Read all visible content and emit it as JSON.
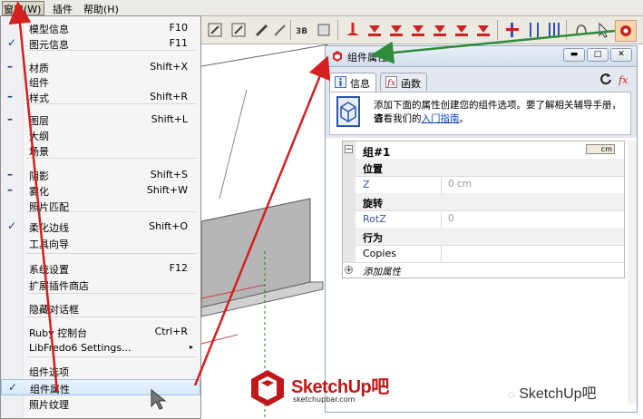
{
  "menubar": {
    "window": "窗口(W)",
    "plugins": "插件",
    "help": "帮助(H)"
  },
  "menu": {
    "items": [
      {
        "label": "模型信息",
        "shortcut": "F10",
        "mark": ""
      },
      {
        "label": "图元信息",
        "shortcut": "F11",
        "mark": "✓"
      },
      {
        "label": "材质",
        "shortcut": "Shift+X",
        "mark": "–"
      },
      {
        "label": "组件",
        "shortcut": "",
        "mark": ""
      },
      {
        "label": "样式",
        "shortcut": "Shift+R",
        "mark": "–"
      },
      {
        "label": "图层",
        "shortcut": "Shift+L",
        "mark": "–"
      },
      {
        "label": "大纲",
        "shortcut": "",
        "mark": ""
      },
      {
        "label": "场景",
        "shortcut": "",
        "mark": ""
      },
      {
        "label": "阴影",
        "shortcut": "Shift+S",
        "mark": "–"
      },
      {
        "label": "雾化",
        "shortcut": "Shift+W",
        "mark": "–"
      },
      {
        "label": "照片匹配",
        "shortcut": "",
        "mark": ""
      },
      {
        "label": "柔化边线",
        "shortcut": "Shift+O",
        "mark": "✓"
      },
      {
        "label": "工具向导",
        "shortcut": "",
        "mark": ""
      },
      {
        "label": "系统设置",
        "shortcut": "F12",
        "mark": ""
      },
      {
        "label": "扩展插件商店",
        "shortcut": "",
        "mark": ""
      },
      {
        "label": "隐藏对话框",
        "shortcut": "",
        "mark": ""
      },
      {
        "label": "Ruby 控制台",
        "shortcut": "Ctrl+R",
        "mark": ""
      },
      {
        "label": "LibFredo6 Settings...",
        "shortcut": "",
        "mark": "",
        "submenu": "▸"
      },
      {
        "label": "组件选项",
        "shortcut": "",
        "mark": ""
      },
      {
        "label": "组件属性",
        "shortcut": "",
        "mark": "✓"
      },
      {
        "label": "照片纹理",
        "shortcut": "",
        "mark": ""
      }
    ]
  },
  "panel": {
    "title": "组件属性",
    "tabs": [
      {
        "label": "信息"
      },
      {
        "label": "函数"
      }
    ],
    "info_line1": "添加下面的属性创建您的组件选项。要了解相关辅导手册，请",
    "info_line2a": "查看我们的",
    "info_link": "入门指南",
    "info_line2b": "。",
    "group_title": "组#1",
    "unit": "cm",
    "rows": [
      {
        "name": "位置",
        "value": "",
        "type": "section"
      },
      {
        "name": "Z",
        "value": "0 cm",
        "type": "attr"
      },
      {
        "name": "旋转",
        "value": "",
        "type": "section"
      },
      {
        "name": "RotZ",
        "value": "0",
        "type": "attr"
      },
      {
        "name": "行为",
        "value": "",
        "type": "section"
      },
      {
        "name": "Copies",
        "value": "",
        "type": "plain"
      }
    ],
    "add_attr": "添加属性"
  },
  "branding": {
    "logo_text": "SketchUp吧",
    "logo_url": "sketchupbar.com",
    "watermark": "SketchUp吧"
  },
  "colors": {
    "arrow_red": "#d42020",
    "arrow_green": "#2e8b3a",
    "logo_red": "#c0181a"
  },
  "icons": [
    "check-icon",
    "dash-icon",
    "submenu-arrow-icon",
    "sketchup-icon",
    "refresh-icon",
    "minimize-icon",
    "maximize-icon",
    "close-icon",
    "info-icon",
    "function-icon",
    "cube-icon",
    "cm-unit-icon",
    "expand-icon",
    "mouse-cursor-icon",
    "wechat-icon"
  ]
}
